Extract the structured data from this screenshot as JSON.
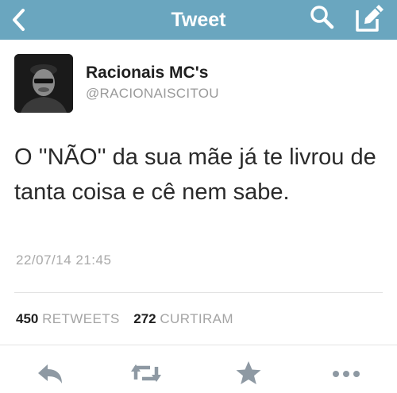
{
  "header": {
    "title": "Tweet",
    "bg_color": "#6aa6bf",
    "back_icon": "chevron-left-icon",
    "search_icon": "search-icon",
    "compose_icon": "compose-icon"
  },
  "tweet": {
    "author_name": "Racionais MC's",
    "author_handle": "@RACIONAISCITOU",
    "text": "O ''NÃO'' da sua mãe já te livrou de tanta coisa e cê nem sabe.",
    "timestamp": "22/07/14 21:45"
  },
  "stats": {
    "retweets_count": "450",
    "retweets_label": "RETWEETS",
    "likes_count": "272",
    "likes_label": "CURTIRAM"
  },
  "actions": {
    "reply_icon": "reply-icon",
    "retweet_icon": "retweet-icon",
    "favorite_icon": "star-icon",
    "more_icon": "more-icon",
    "icon_color": "#8e99a3"
  }
}
